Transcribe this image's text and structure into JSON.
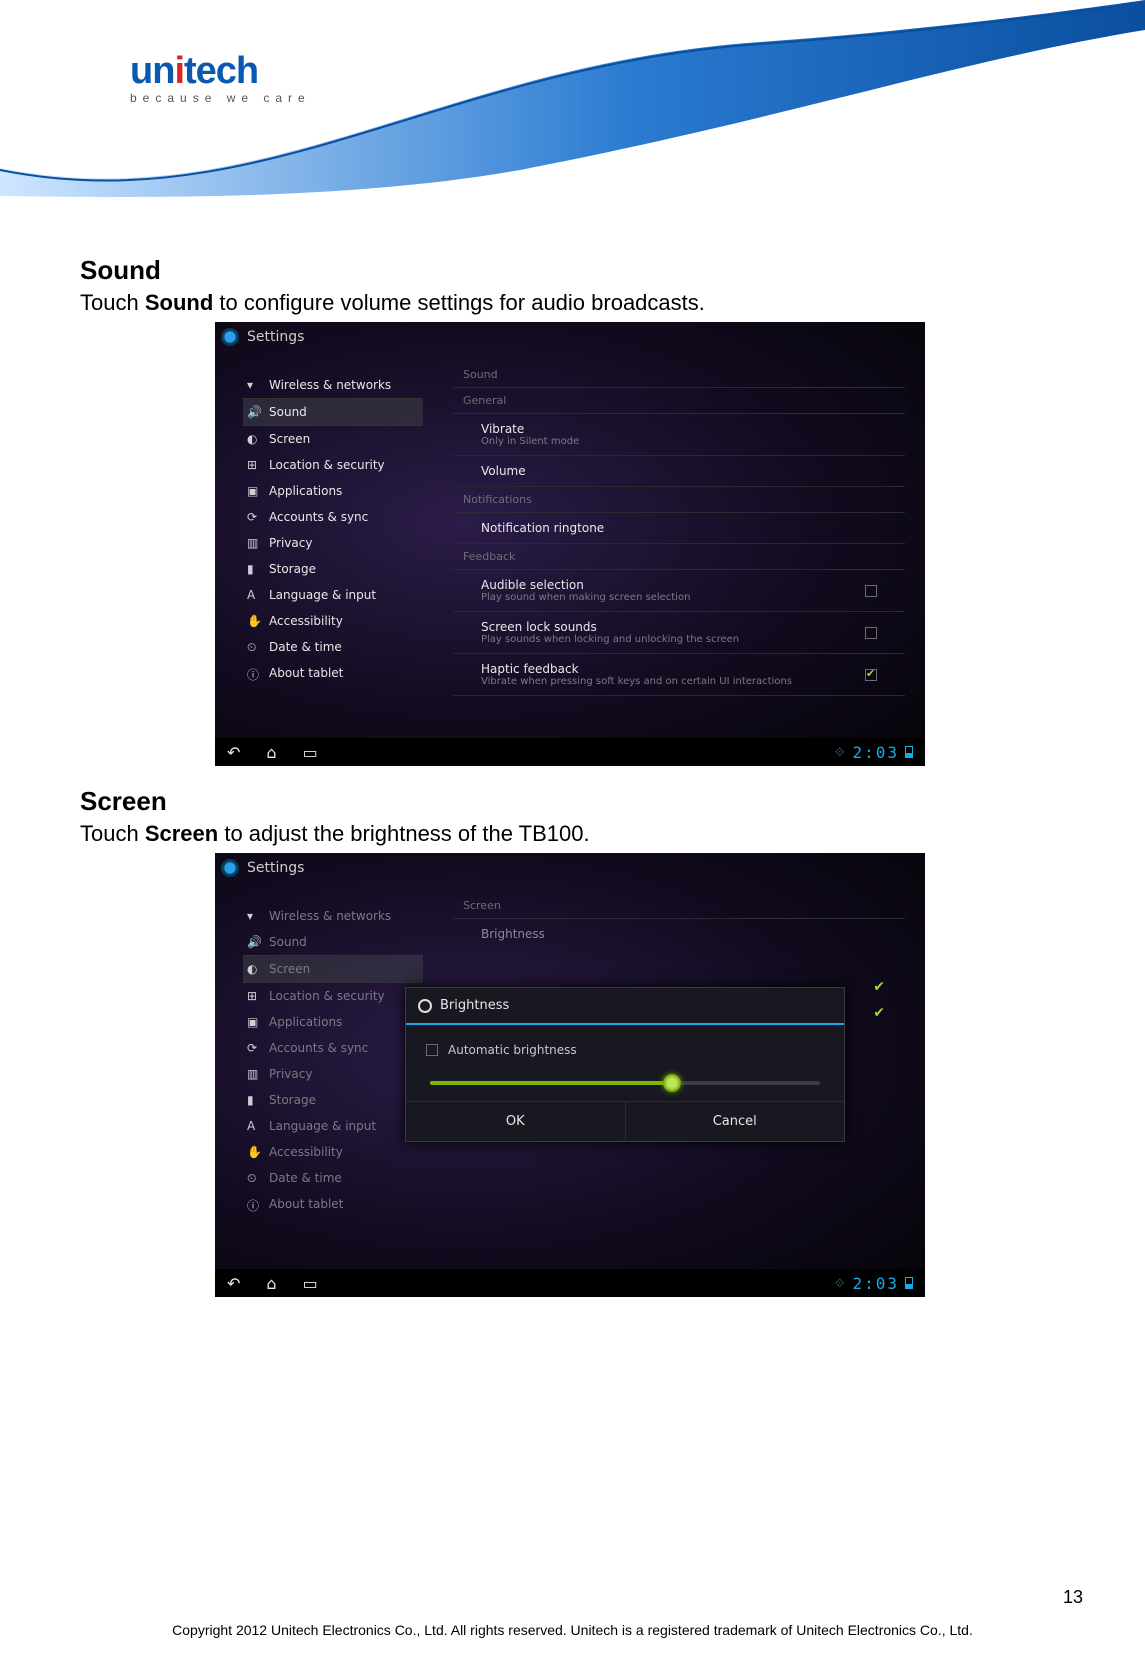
{
  "header": {
    "brand": "unitech",
    "tagline": "because we care"
  },
  "sections": {
    "sound": {
      "heading": "Sound",
      "desc_pre": "Touch ",
      "desc_bold": "Sound",
      "desc_post": " to configure volume settings for audio broadcasts."
    },
    "screen": {
      "heading": "Screen",
      "desc_pre": "Touch ",
      "desc_bold": "Screen",
      "desc_post": " to adjust the brightness of the TB100."
    }
  },
  "shot1": {
    "window_title": "Settings",
    "sidebar": [
      {
        "icon": "wifi-icon",
        "label": "Wireless & networks",
        "selected": false,
        "dim": false
      },
      {
        "icon": "sound-icon",
        "label": "Sound",
        "selected": true,
        "dim": false
      },
      {
        "icon": "screen-icon",
        "label": "Screen",
        "selected": false,
        "dim": false
      },
      {
        "icon": "location-icon",
        "label": "Location & security",
        "selected": false,
        "dim": false
      },
      {
        "icon": "apps-icon",
        "label": "Applications",
        "selected": false,
        "dim": false
      },
      {
        "icon": "sync-icon",
        "label": "Accounts & sync",
        "selected": false,
        "dim": false
      },
      {
        "icon": "privacy-icon",
        "label": "Privacy",
        "selected": false,
        "dim": false
      },
      {
        "icon": "storage-icon",
        "label": "Storage",
        "selected": false,
        "dim": false
      },
      {
        "icon": "language-icon",
        "label": "Language & input",
        "selected": false,
        "dim": false
      },
      {
        "icon": "accessibility-icon",
        "label": "Accessibility",
        "selected": false,
        "dim": false
      },
      {
        "icon": "datetime-icon",
        "label": "Date & time",
        "selected": false,
        "dim": false
      },
      {
        "icon": "about-icon",
        "label": "About tablet",
        "selected": false,
        "dim": false
      }
    ],
    "panel_title": "Sound",
    "groups": {
      "general": {
        "heading": "General",
        "vibrate": {
          "title": "Vibrate",
          "sub": "Only in Silent mode"
        },
        "volume": {
          "title": "Volume"
        }
      },
      "notifications": {
        "heading": "Notifications",
        "ringtone": {
          "title": "Notification ringtone"
        }
      },
      "feedback": {
        "heading": "Feedback",
        "audible": {
          "title": "Audible selection",
          "sub": "Play sound when making screen selection",
          "checked": false
        },
        "lock": {
          "title": "Screen lock sounds",
          "sub": "Play sounds when locking and unlocking the screen",
          "checked": false
        },
        "haptic": {
          "title": "Haptic feedback",
          "sub": "Vibrate when pressing soft keys and on certain UI interactions",
          "checked": true
        }
      }
    },
    "status_time": "2:03"
  },
  "shot2": {
    "window_title": "Settings",
    "sidebar": [
      {
        "icon": "wifi-icon",
        "label": "Wireless & networks",
        "selected": false,
        "dim": true
      },
      {
        "icon": "sound-icon",
        "label": "Sound",
        "selected": false,
        "dim": true
      },
      {
        "icon": "screen-icon",
        "label": "Screen",
        "selected": true,
        "dim": true
      },
      {
        "icon": "location-icon",
        "label": "Location & security",
        "selected": false,
        "dim": true
      },
      {
        "icon": "apps-icon",
        "label": "Applications",
        "selected": false,
        "dim": true
      },
      {
        "icon": "sync-icon",
        "label": "Accounts & sync",
        "selected": false,
        "dim": true
      },
      {
        "icon": "privacy-icon",
        "label": "Privacy",
        "selected": false,
        "dim": true
      },
      {
        "icon": "storage-icon",
        "label": "Storage",
        "selected": false,
        "dim": true
      },
      {
        "icon": "language-icon",
        "label": "Language & input",
        "selected": false,
        "dim": true
      },
      {
        "icon": "accessibility-icon",
        "label": "Accessibility",
        "selected": false,
        "dim": true
      },
      {
        "icon": "datetime-icon",
        "label": "Date & time",
        "selected": false,
        "dim": true
      },
      {
        "icon": "about-icon",
        "label": "About tablet",
        "selected": false,
        "dim": true
      }
    ],
    "panel_title": "Screen",
    "rows": {
      "brightness": "Brightness"
    },
    "dialog": {
      "title": "Brightness",
      "auto_label": "Automatic brightness",
      "auto_checked": false,
      "slider_pct": 62,
      "ok": "OK",
      "cancel": "Cancel"
    },
    "status_time": "2:03"
  },
  "footer": {
    "page_number": "13",
    "copyright": "Copyright 2012 Unitech Electronics Co., Ltd. All rights reserved. Unitech is a registered trademark of Unitech Electronics Co., Ltd."
  }
}
